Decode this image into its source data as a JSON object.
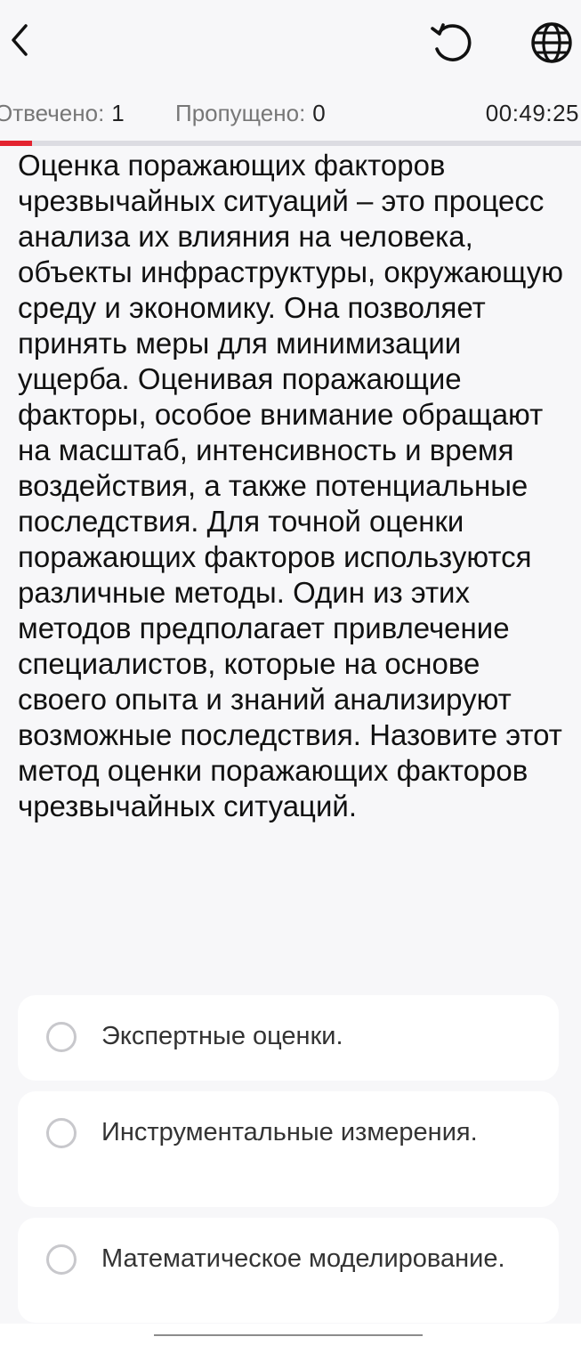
{
  "header": {
    "back_icon": "chevron-left-icon",
    "reset_icon": "reset-icon",
    "language_icon": "globe-icon"
  },
  "status": {
    "answered_label": "Отвечено:",
    "answered_count": "1",
    "skipped_label": "Пропущено:",
    "skipped_count": "0",
    "timer": "00:49:25"
  },
  "progress": {
    "fraction": 0.055,
    "color": "#e3232f"
  },
  "question": {
    "text": "Оценка поражающих факторов чрезвычайных ситуаций – это процесс анализа их влияния на человека, объекты инфраструктуры, окружающую среду и экономику. Она позволяет принять меры для минимизации ущерба. Оценивая поражающие факторы, особое внимание обращают на масштаб, интенсивность и время воздействия, а также потенциальные последствия. Для точной оценки поражающих факторов используются различные методы. Один из этих методов предполагает привлечение специалистов, которые на основе своего опыта и знаний анализируют возможные последствия. Назовите этот метод оценки поражающих факторов чрезвычайных ситуаций."
  },
  "options": [
    {
      "label": "Экспертные оценки.",
      "selected": false
    },
    {
      "label": "Инструментальные измерения.",
      "selected": false
    },
    {
      "label": "Математическое моделирование.",
      "selected": false
    }
  ]
}
